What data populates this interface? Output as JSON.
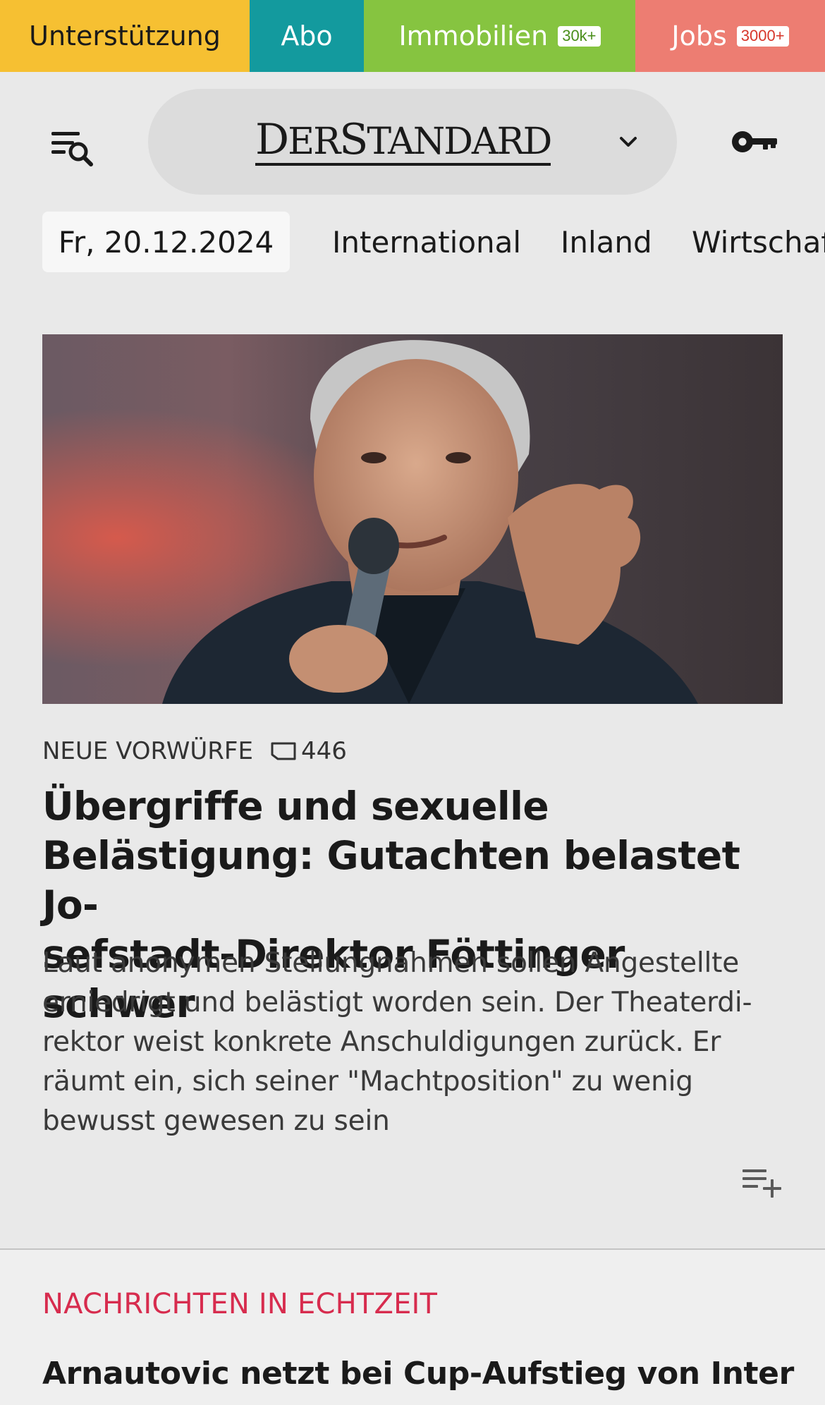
{
  "servicebar": {
    "support": {
      "label": "Unterstützung",
      "color": "#f6c032"
    },
    "abo": {
      "label": "Abo",
      "color": "#139a9e"
    },
    "immobilien": {
      "label": "Immobilien",
      "badge": "30k+",
      "color": "#86c440"
    },
    "jobs": {
      "label": "Jobs",
      "badge": "3000+",
      "color": "#ed7d72"
    }
  },
  "header": {
    "menu_icon": "menu-search-icon",
    "logo": {
      "part1": "D",
      "part2": "ER",
      "part3": "S",
      "part4": "TANDARD"
    },
    "chevron_icon": "chevron-down-icon",
    "login_icon": "key-icon"
  },
  "nav": {
    "date": "Fr, 20.12.2024",
    "items": [
      "International",
      "Inland",
      "Wirtschaft"
    ]
  },
  "lead": {
    "image_alt": "Mann mit grauen Haaren spricht in ein Mikrofon",
    "kicker": "NEUE VORWÜRFE",
    "comment_icon": "comment-icon",
    "comment_count": "446",
    "title": "Übergriffe und sexuelle Belästigung: Gutachten belastet Jo­sefstadt-Direktor Föttinger schwer",
    "title_lines": [
      "Übergriffe und sexuelle",
      "Belästigung: Gutachten belastet Jo-",
      "sefstadt-Direktor Föttinger schwer"
    ],
    "teaser_lines": [
      "Laut anonymen Stellungnahmen sollen Angestellte",
      "erniedrigt und belästigt worden sein. Der Theaterdi-",
      "rektor weist konkrete Anschuldigungen zurück. Er",
      "räumt ein, sich seiner \"Machtposition\" zu wenig",
      "bewusst gewesen zu sein"
    ],
    "playlist_icon": "playlist-add-icon"
  },
  "live": {
    "heading": "NACHRICHTEN IN ECHTZEIT",
    "heading_color": "#d72c4e",
    "first_item": "Arnautovic netzt bei Cup-Aufstieg von Inter"
  }
}
